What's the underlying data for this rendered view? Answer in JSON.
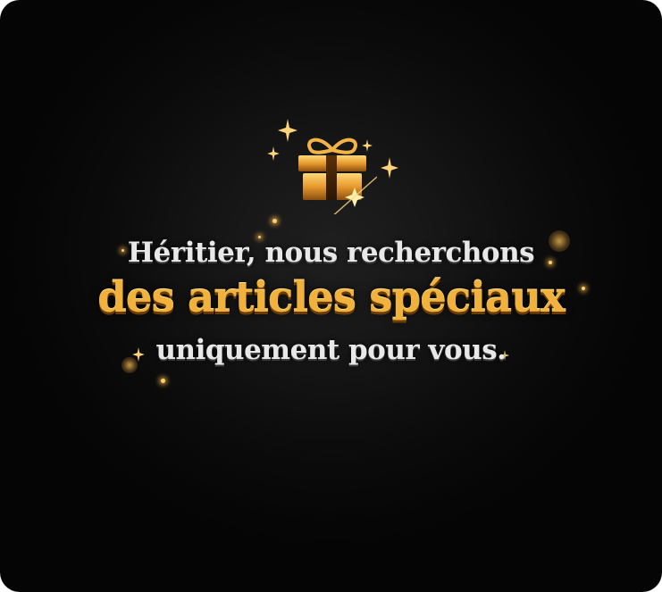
{
  "message": {
    "line1": "Héritier, nous recherchons",
    "line2": "des articles spéciaux",
    "line3": "uniquement pour vous."
  },
  "icons": {
    "main": "gift-icon",
    "decorations": "sparkle-icon"
  },
  "colors": {
    "background": "#0b0b0b",
    "accent_gold": "#f0b23c",
    "text_light": "#e8e8e8"
  }
}
